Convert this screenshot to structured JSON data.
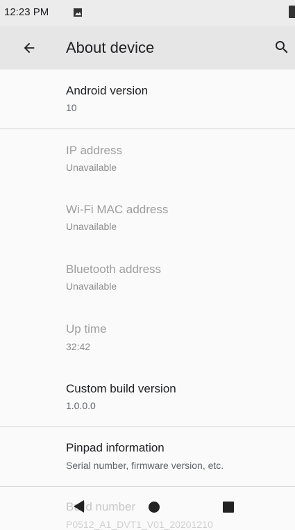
{
  "status_bar": {
    "time": "12:23 PM"
  },
  "app_bar": {
    "title": "About device"
  },
  "items": [
    {
      "title": "Android version",
      "summary": "10"
    },
    {
      "title": "IP address",
      "summary": "Unavailable"
    },
    {
      "title": "Wi-Fi MAC address",
      "summary": "Unavailable"
    },
    {
      "title": "Bluetooth address",
      "summary": "Unavailable"
    },
    {
      "title": "Up time",
      "summary": "32:42"
    },
    {
      "title": "Custom build version",
      "summary": "1.0.0.0"
    },
    {
      "title": "Pinpad information",
      "summary": "Serial number, firmware version, etc."
    },
    {
      "title": "Build number",
      "summary": "P0512_A1_DVT1_V01_20201210"
    }
  ]
}
